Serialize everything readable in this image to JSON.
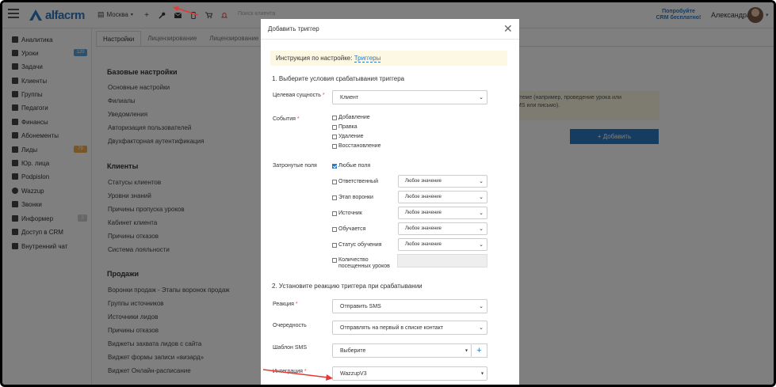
{
  "topbar": {
    "logo_text": "alfacrm",
    "branch": "Москва",
    "search_placeholder": "Поиск клиента",
    "promo_line1": "Попробуйте",
    "promo_line2": "CRM бесплатно!",
    "user_name": "Александра"
  },
  "sidebar": {
    "items": [
      {
        "label": "Аналитика",
        "icon": "chart-icon"
      },
      {
        "label": "Уроки",
        "icon": "calendar-icon",
        "badge": "120"
      },
      {
        "label": "Задачи",
        "icon": "tasks-icon"
      },
      {
        "label": "Клиенты",
        "icon": "user-icon"
      },
      {
        "label": "Группы",
        "icon": "group-icon"
      },
      {
        "label": "Педагоги",
        "icon": "teacher-icon"
      },
      {
        "label": "Финансы",
        "icon": "money-icon"
      },
      {
        "label": "Абонементы",
        "icon": "tag-icon"
      },
      {
        "label": "Лиды",
        "icon": "leads-icon",
        "badge": "79"
      },
      {
        "label": "Юр. лица",
        "icon": "building-icon"
      },
      {
        "label": "Podpislon",
        "icon": "document-icon"
      },
      {
        "label": "Wazzup",
        "icon": "whatsapp-icon"
      },
      {
        "label": "Звонки",
        "icon": "phone-icon"
      },
      {
        "label": "Информер",
        "icon": "informer-icon",
        "badge": "1"
      },
      {
        "label": "Доступ в CRM",
        "icon": "lock-icon"
      },
      {
        "label": "Внутренний чат",
        "icon": "chat-icon"
      }
    ],
    "badge_colors": {
      "blue": "#5ba3d9",
      "orange": "#f0ad4e",
      "grey": "#cfcfcf"
    }
  },
  "tabs": [
    "Настройки",
    "Лицензирование",
    "Лицензирование (р"
  ],
  "content": {
    "groups": [
      {
        "title": "Базовые настройки",
        "links": [
          "Основные настройки",
          "Филиалы",
          "Уведомления",
          "Авторизация пользователей",
          "Двухфакторная аутентификация"
        ]
      },
      {
        "title": "Клиенты",
        "links": [
          "Статусы клиентов",
          "Уровни знаний",
          "Причины пропуска уроков",
          "Кабинет клиента",
          "Причины отказов",
          "Система лояльности"
        ]
      },
      {
        "title": "Продажи",
        "links": [
          "Воронки продаж - Этапы воронок продаж",
          "Группы источников",
          "Источники лидов",
          "Причины отказов",
          "Виджеты захвата лидов с сайта",
          "Виджет формы записи «визард»",
          "Виджет Онлайн-расписание"
        ]
      }
    ],
    "notice_line1": "стеме (например, проведение урока или",
    "notice_line2": "MS или письмо).",
    "add_button": "+ Добавить"
  },
  "modal": {
    "title": "Добавить триггер",
    "instruction_prefix": "Инструкция по настройке:",
    "instruction_link": "Триггеры",
    "section1": "1. Выберите условия срабатывания триггера",
    "target_label": "Целевая сущность",
    "target_value": "Клиент",
    "events_label": "События",
    "events": [
      "Добавление",
      "Правка",
      "Удаление",
      "Восстановление"
    ],
    "fields_label": "Затронутые поля",
    "any_fields": "Любые поля",
    "fields": [
      {
        "label": "Ответственный",
        "value": "Любое значение"
      },
      {
        "label": "Этап воронки",
        "value": "Любое значение"
      },
      {
        "label": "Источник",
        "value": "Любое значение"
      },
      {
        "label": "Обучается",
        "value": "Любое значение"
      },
      {
        "label": "Статус обучения",
        "value": "Любое значение"
      }
    ],
    "count_label_line1": "Количество",
    "count_label_line2": "посещенных уроков",
    "section2": "2. Установите реакцию триггера при срабатывании",
    "reaction_label": "Реакция",
    "reaction_value": "Отправить SMS",
    "order_label": "Очередность",
    "order_value": "Отправлять на первый в списке контакт",
    "template_label": "Шаблон SMS",
    "template_value": "Выберите",
    "integration_label": "Интеграция",
    "integration_value": "WazzupV3"
  },
  "colors": {
    "brand": "#2b79c2",
    "required": "#d9534f",
    "arrow": "#e53935",
    "notice_bg": "#fcf8e3"
  }
}
